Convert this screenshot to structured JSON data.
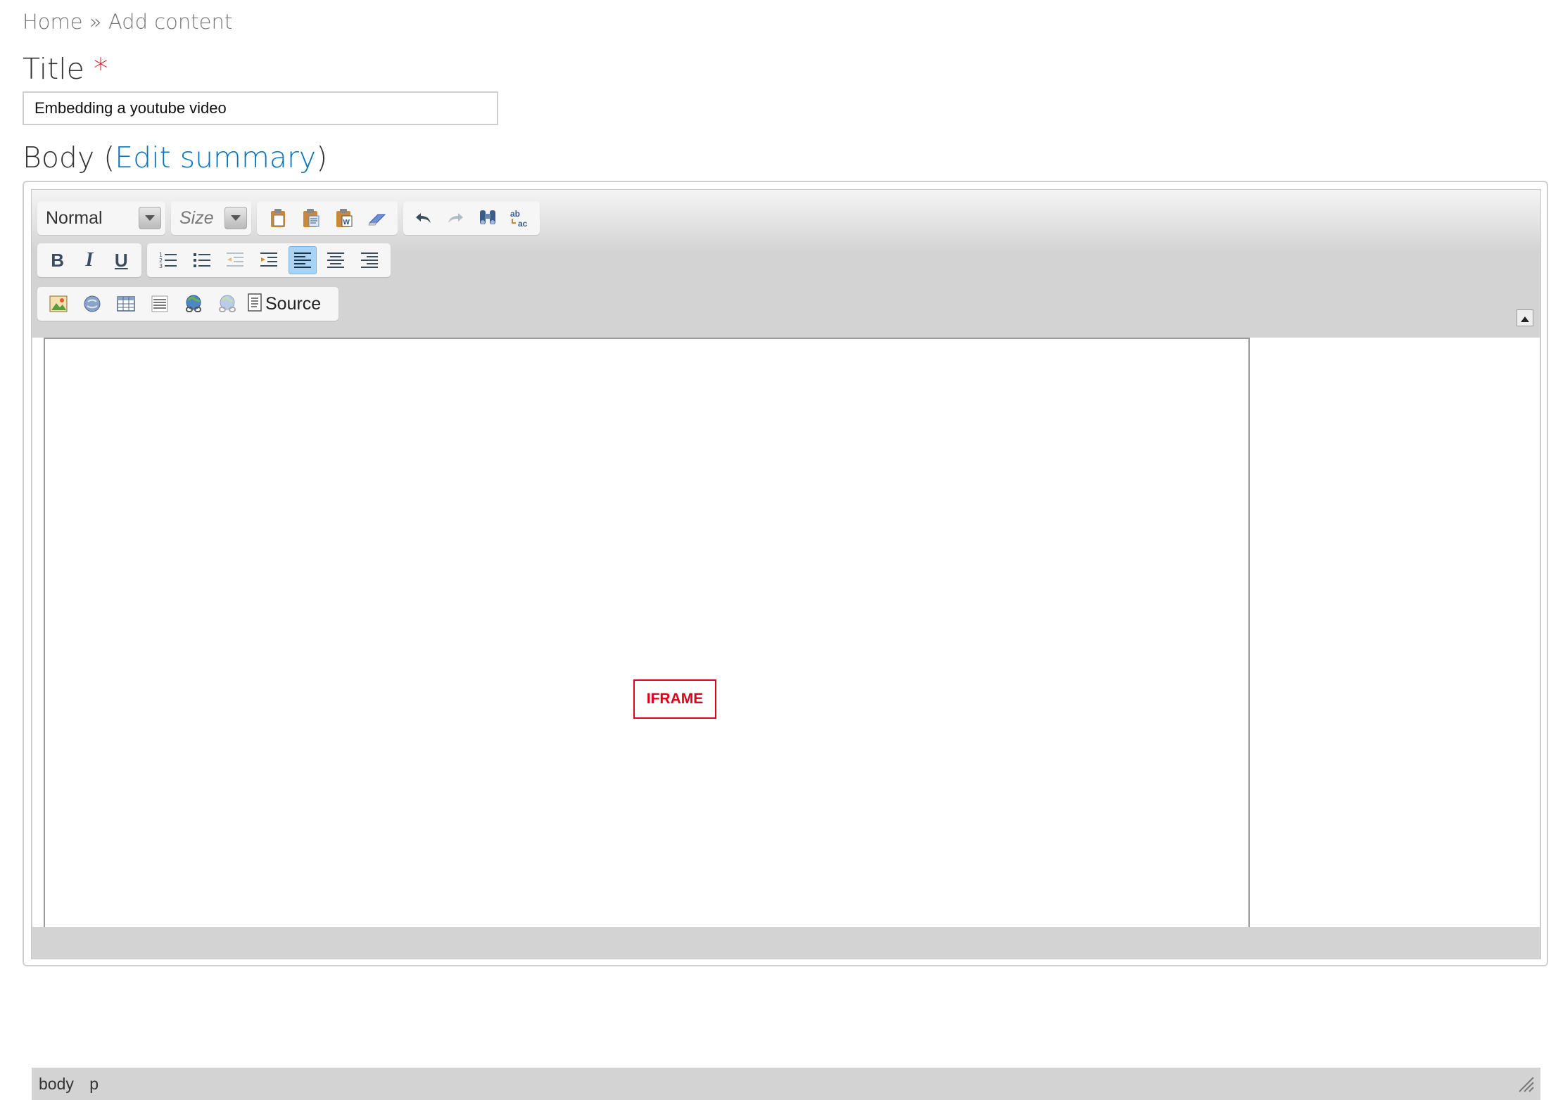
{
  "breadcrumb": {
    "home": "Home",
    "separator": "»",
    "current": "Add content"
  },
  "title_field": {
    "label": "Title",
    "required_mark": "*",
    "value": "Embedding a youtube video"
  },
  "body_field": {
    "label": "Body",
    "open_paren": "(",
    "edit_summary_link": "Edit summary",
    "close_paren": ")"
  },
  "toolbar": {
    "format_combo": "Normal",
    "size_combo": "Size",
    "source_label": "Source",
    "icons": {
      "clipboard": [
        "paste-icon",
        "paste-text-icon",
        "paste-from-word-icon",
        "remove-format-icon"
      ],
      "history": [
        "undo-icon",
        "redo-icon",
        "find-icon",
        "replace-icon"
      ],
      "basic": [
        "bold-icon",
        "italic-icon",
        "underline-icon"
      ],
      "lists_align": [
        "numbered-list-icon",
        "bulleted-list-icon",
        "outdent-icon",
        "indent-icon",
        "align-left-icon",
        "align-center-icon",
        "align-right-icon"
      ],
      "insert": [
        "image-icon",
        "flash-icon",
        "table-icon",
        "horizontal-rule-icon",
        "link-icon",
        "unlink-icon",
        "source-icon"
      ]
    },
    "active_button": "align-left-icon"
  },
  "content": {
    "iframe_placeholder": "IFRAME"
  },
  "statusbar": {
    "path": [
      "body",
      "p"
    ]
  },
  "colors": {
    "required": "#e0001a",
    "link": "#0a74b8",
    "active_button_bg": "#a9d3f5"
  }
}
